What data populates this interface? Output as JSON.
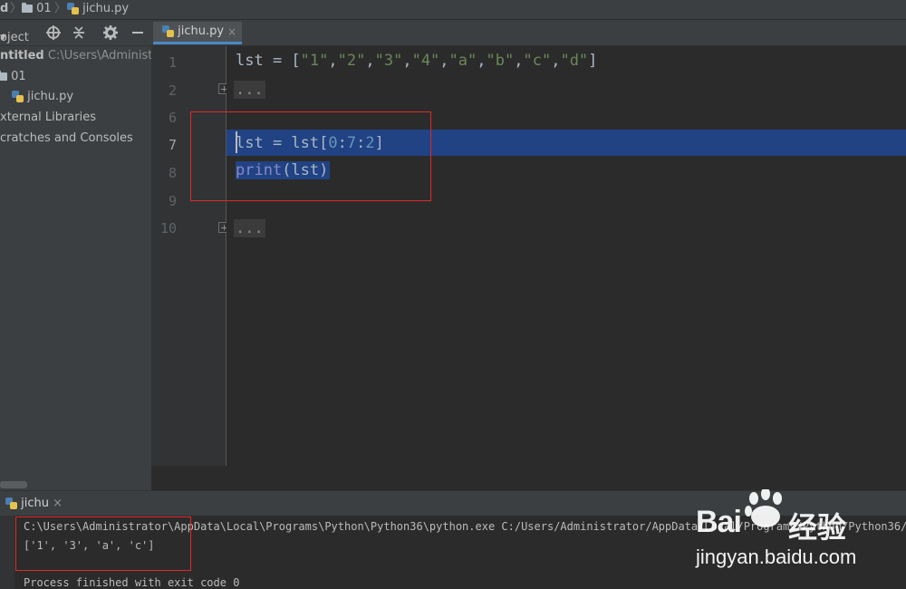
{
  "navbar": {
    "crumb_project": "d",
    "crumb_folder": "01",
    "crumb_file": "jichu.py"
  },
  "project_panel": {
    "toolbar_label": "oject",
    "toolbar_dropdown": "▾",
    "icons": [
      "target-icon",
      "collapse-icon",
      "gear-icon",
      "minimize-icon"
    ],
    "tree": [
      {
        "label": "ntitled",
        "path": "C:\\Users\\Administ"
      },
      {
        "label": "01"
      },
      {
        "label": "jichu.py"
      },
      {
        "label": "xternal Libraries"
      },
      {
        "label": "cratches and Consoles"
      }
    ]
  },
  "editor": {
    "tab_label": "jichu.py",
    "tab_close": "×",
    "line_numbers": [
      "1",
      "2",
      "6",
      "7",
      "8",
      "9",
      "10"
    ],
    "line1": {
      "var": "lst",
      "op": " = [",
      "items": [
        "\"1\"",
        "\"2\"",
        "\"3\"",
        "\"4\"",
        "\"a\"",
        "\"b\"",
        "\"c\"",
        "\"d\""
      ],
      "close": "]"
    },
    "folded_text": "...",
    "line7": {
      "var": "lst",
      "mid": " = lst[",
      "n0": "0",
      "c1": ":",
      "n1": "7",
      "c2": ":",
      "n2": "2",
      "close": "]"
    },
    "line8": {
      "func": "print",
      "args": "(lst)"
    },
    "folded_text_2": "..."
  },
  "run_panel": {
    "tab_label": "jichu",
    "tab_close": "×",
    "console_lines": [
      "C:\\Users\\Administrator\\AppData\\Local\\Programs\\Python\\Python36\\python.exe C:/Users/Administrator/AppData/Local/Programs/Python/Python36/unti",
      "['1', '3', 'a', 'c']",
      "",
      "Process finished with exit code 0"
    ]
  },
  "watermark": {
    "brand_text": "Bai",
    "brand_cn": "经验",
    "url": "jingyan.baidu.com"
  },
  "colors": {
    "selection": "#214283",
    "annotation_red": "#e0292b",
    "string_green": "#6a8759",
    "number_blue": "#6897bb",
    "builtin_purple": "#8888c6"
  }
}
